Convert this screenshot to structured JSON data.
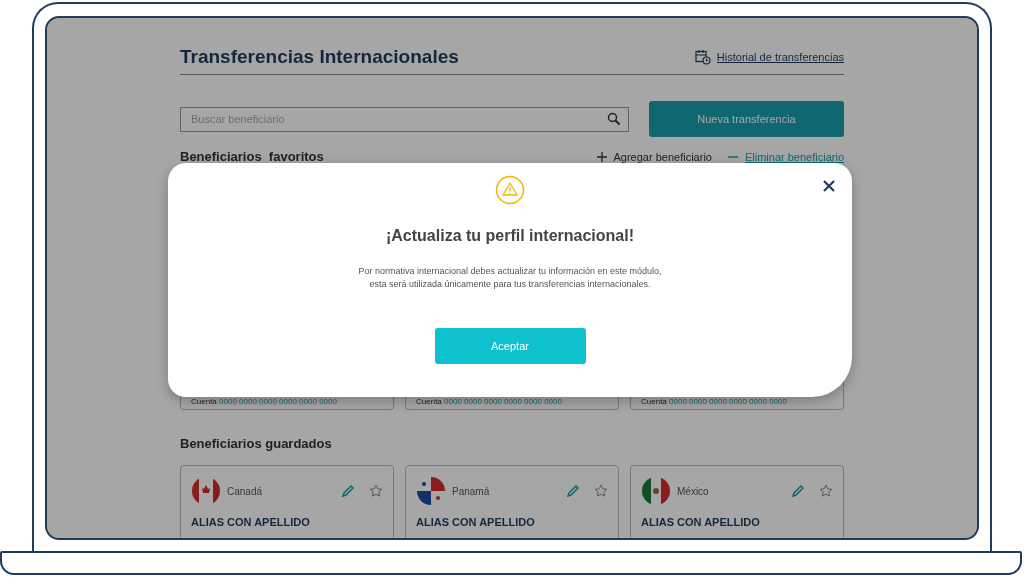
{
  "page": {
    "title": "Transferencias Internacionales",
    "history_link": "Historial de transferencias"
  },
  "search": {
    "placeholder": "Buscar beneficiario"
  },
  "new_transfer_button": "Nueva transferencia",
  "favorites": {
    "heading": "Beneficiarios  favoritos",
    "add_link": "Agregar beneficiario",
    "remove_link": "Eliminar beneficiario",
    "cards": [
      {
        "account_label": "Cuenta",
        "account": "0000 0000 0000 0000 0000 0000"
      },
      {
        "account_label": "Cuenta",
        "account": "0000 0000 0000 0000 0000 0000"
      },
      {
        "account_label": "Cuenta",
        "account": "0000 0000 0000 0000 0000 0000"
      }
    ]
  },
  "saved": {
    "heading": "Beneficiarios guardados",
    "cards": [
      {
        "kind": "canada",
        "country": "Canadá",
        "alias": "ALIAS CON APELLIDO",
        "favorite": false
      },
      {
        "kind": "panama",
        "country": "Panamá",
        "alias": "ALIAS CON APELLIDO",
        "favorite": false
      },
      {
        "kind": "mexico",
        "country": "México",
        "alias": "ALIAS CON APELLIDO",
        "favorite": false
      }
    ]
  },
  "modal": {
    "title": "¡Actualiza tu perfil internacional!",
    "message": "Por normativa internacional debes actualizar tu información en este módulo,\nesta será utilizada únicamente para tus transferencias internacionales.",
    "accept_button": "Aceptar"
  }
}
